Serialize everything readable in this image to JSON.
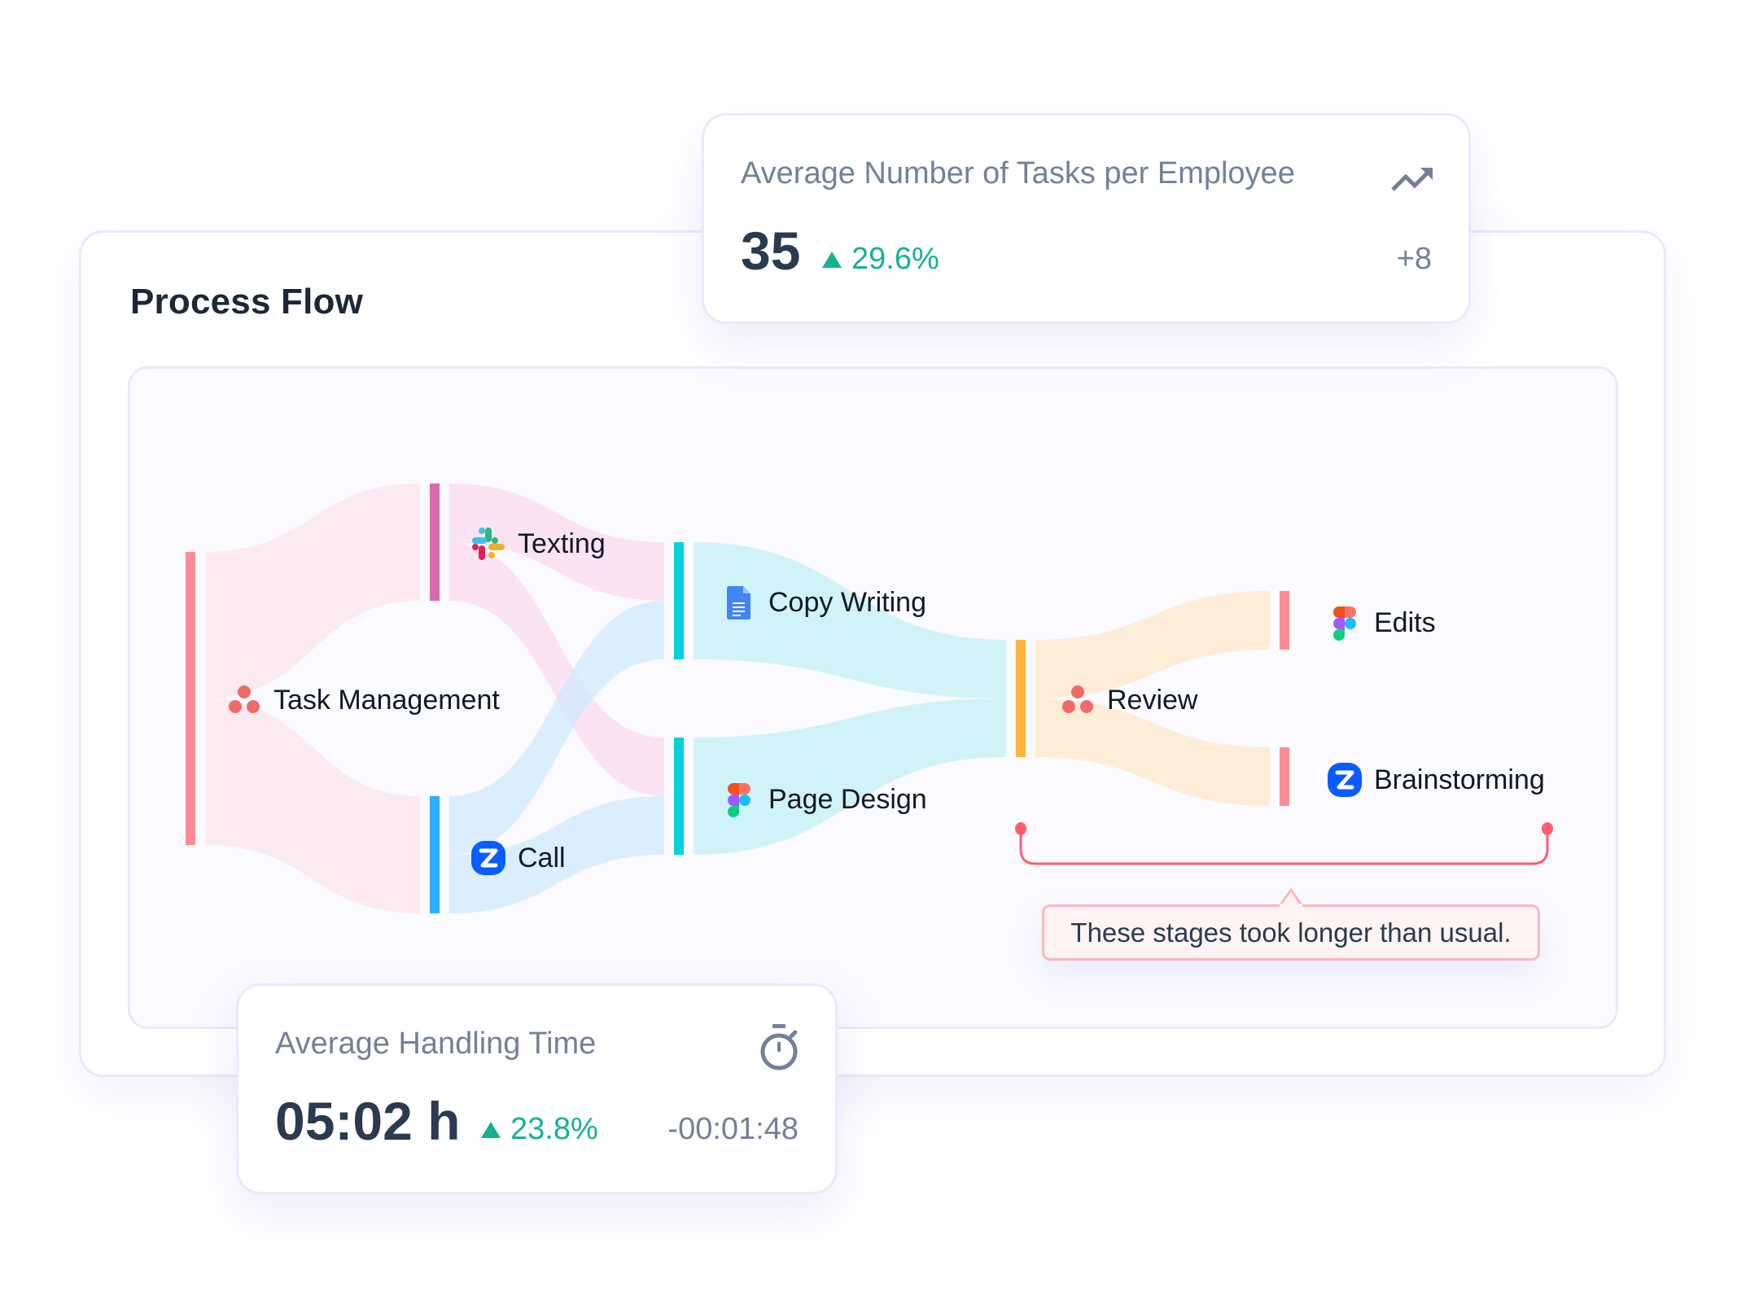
{
  "process_flow": {
    "title": "Process Flow"
  },
  "chart_data": {
    "type": "sankey",
    "title": "Process Flow",
    "nodes": [
      {
        "id": "task_management",
        "label": "Task Management",
        "icon": "asana-icon",
        "color": "#ff8a92",
        "column": 0
      },
      {
        "id": "texting",
        "label": "Texting",
        "icon": "slack-icon",
        "color": "#da68ad",
        "column": 1
      },
      {
        "id": "call",
        "label": "Call",
        "icon": "zoom-icon",
        "color": "#30aefe",
        "column": 1
      },
      {
        "id": "copy_writing",
        "label": "Copy Writing",
        "icon": "google-docs-icon",
        "color": "#00d1dc",
        "column": 2
      },
      {
        "id": "page_design",
        "label": "Page Design",
        "icon": "figma-icon",
        "color": "#00d1dc",
        "column": 2
      },
      {
        "id": "review",
        "label": "Review",
        "icon": "asana-icon",
        "color": "#ffb53b",
        "column": 3
      },
      {
        "id": "edits",
        "label": "Edits",
        "icon": "figma-icon",
        "color": "#ff8a92",
        "column": 4
      },
      {
        "id": "brainstorming",
        "label": "Brainstorming",
        "icon": "zoom-icon",
        "color": "#ff8a92",
        "column": 4
      }
    ],
    "links": [
      {
        "source": "task_management",
        "target": "texting",
        "value": 2,
        "color": "#fbe2e8"
      },
      {
        "source": "task_management",
        "target": "call",
        "value": 2,
        "color": "#fbe2e8"
      },
      {
        "source": "texting",
        "target": "copy_writing",
        "value": 1,
        "color": "#fcd9ee"
      },
      {
        "source": "texting",
        "target": "page_design",
        "value": 1,
        "color": "#fcd9ee"
      },
      {
        "source": "call",
        "target": "copy_writing",
        "value": 1,
        "color": "#cde8fd"
      },
      {
        "source": "call",
        "target": "page_design",
        "value": 1,
        "color": "#cde8fd"
      },
      {
        "source": "copy_writing",
        "target": "review",
        "value": 1,
        "color": "#bdeff4"
      },
      {
        "source": "page_design",
        "target": "review",
        "value": 1,
        "color": "#bdeff4"
      },
      {
        "source": "review",
        "target": "edits",
        "value": 1,
        "color": "#fde6c8"
      },
      {
        "source": "review",
        "target": "brainstorming",
        "value": 1,
        "color": "#fde6c8"
      }
    ],
    "annotation": {
      "text": "These stages took longer than usual.",
      "spans": [
        "review",
        "edits",
        "brainstorming"
      ],
      "color": "#ff5f6d"
    }
  },
  "cards": {
    "tasks_per_employee": {
      "title": "Average Number of Tasks per Employee",
      "value": "35",
      "delta": "29.6%",
      "delta_direction": "up",
      "sub_value": "+8",
      "icon": "trending-up-icon"
    },
    "handling_time": {
      "title": "Average Handling Time",
      "value": "05:02 h",
      "delta": "23.8%",
      "delta_direction": "up",
      "sub_value": "-00:01:48",
      "icon": "stopwatch-icon"
    }
  },
  "colors": {
    "positive": "#16b193",
    "muted_text": "#74809a",
    "annotation": "#ff5f6d"
  }
}
